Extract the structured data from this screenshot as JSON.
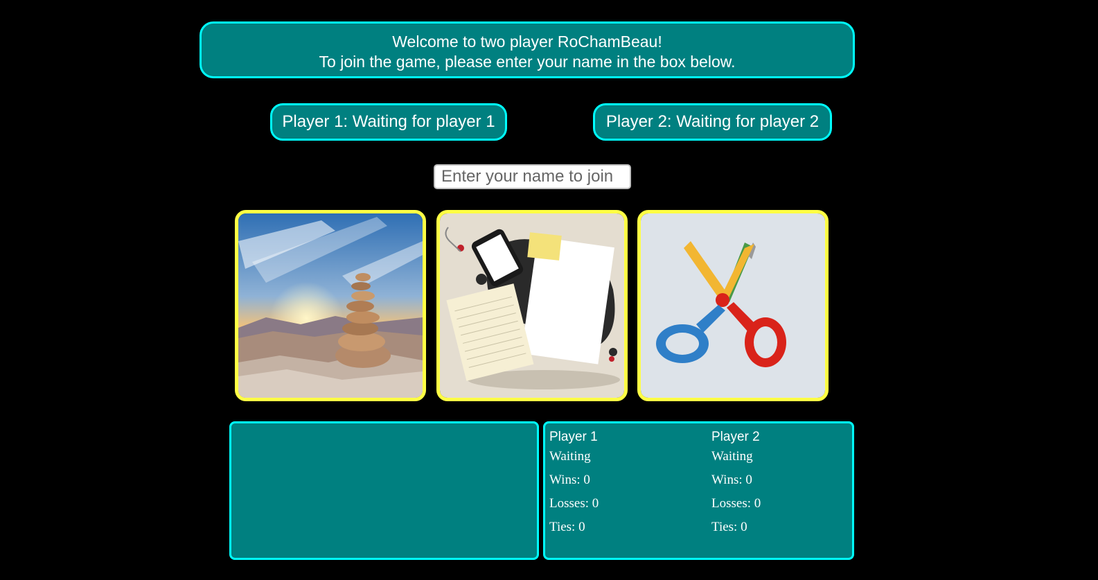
{
  "welcome": {
    "line1": "Welcome to two player RoChamBeau!",
    "line2": "To join the game, please enter your name in the box below."
  },
  "players": {
    "p1_status": "Player 1: Waiting for player 1",
    "p2_status": "Player 2: Waiting for player 2"
  },
  "join": {
    "placeholder": "Enter your name to join",
    "value": ""
  },
  "choices": [
    {
      "name": "rock",
      "image": "stacked-rocks-sunset"
    },
    {
      "name": "paper",
      "image": "paper-and-phone-collage"
    },
    {
      "name": "scissors",
      "image": "zigzag-scissors"
    }
  ],
  "message": "",
  "scoreboard": {
    "player1": {
      "title": "Player 1",
      "status": "Waiting",
      "wins": "Wins: 0",
      "losses": "Losses: 0",
      "ties": "Ties: 0"
    },
    "player2": {
      "title": "Player 2",
      "status": "Waiting",
      "wins": "Wins: 0",
      "losses": "Losses: 0",
      "ties": "Ties: 0"
    }
  },
  "colors": {
    "background": "#000000",
    "panel": "#008080",
    "panel_border": "#00FFFF",
    "choice_border": "#FFFF44",
    "text": "#FFFFFF"
  }
}
